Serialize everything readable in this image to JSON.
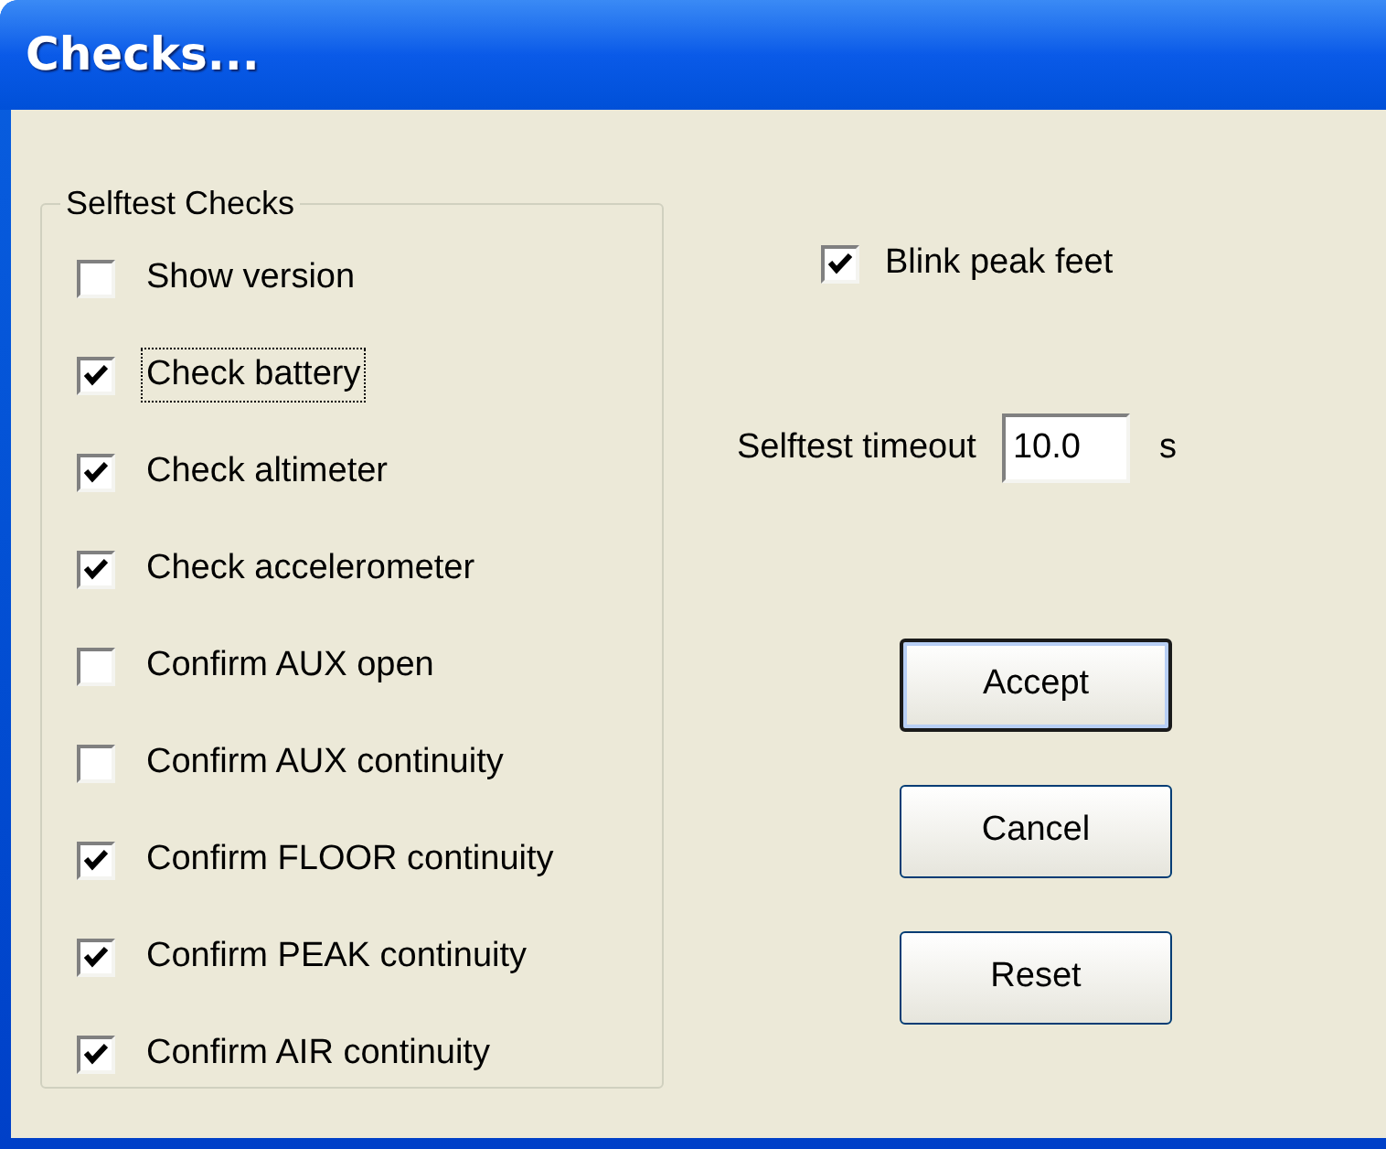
{
  "window": {
    "title": "Checks..."
  },
  "selftest_checks": {
    "title": "Selftest Checks",
    "items": [
      {
        "label": "Show version",
        "checked": false,
        "focused": false
      },
      {
        "label": "Check battery",
        "checked": true,
        "focused": true
      },
      {
        "label": "Check altimeter",
        "checked": true,
        "focused": false
      },
      {
        "label": "Check accelerometer",
        "checked": true,
        "focused": false
      },
      {
        "label": "Confirm AUX open",
        "checked": false,
        "focused": false
      },
      {
        "label": "Confirm AUX continuity",
        "checked": false,
        "focused": false
      },
      {
        "label": "Confirm FLOOR continuity",
        "checked": true,
        "focused": false
      },
      {
        "label": "Confirm PEAK continuity",
        "checked": true,
        "focused": false
      },
      {
        "label": "Confirm AIR continuity",
        "checked": true,
        "focused": false
      }
    ]
  },
  "blink_peak_feet": {
    "label": "Blink peak feet",
    "checked": true
  },
  "selftest_timeout": {
    "label": "Selftest timeout",
    "value": "10.0",
    "unit": "s"
  },
  "buttons": [
    {
      "label": "Accept",
      "default": true
    },
    {
      "label": "Cancel",
      "default": false
    },
    {
      "label": "Reset",
      "default": false
    }
  ]
}
